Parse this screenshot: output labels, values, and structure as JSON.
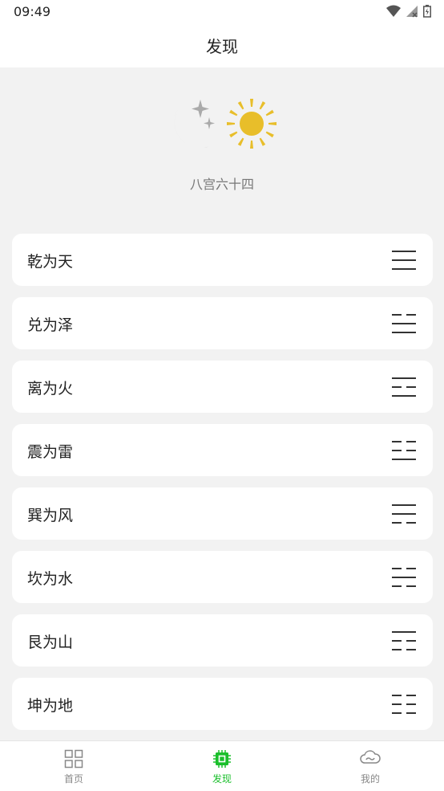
{
  "status_bar": {
    "time": "09:49"
  },
  "header": {
    "title": "发现"
  },
  "hero": {
    "subtitle": "八宫六十四"
  },
  "colors": {
    "accent": "#1bbf2c",
    "sun": "#e8be2a",
    "moon": "#aaaaaa"
  },
  "hexagrams": [
    {
      "label": "乾为天",
      "lines": [
        "yang",
        "yang",
        "yang"
      ]
    },
    {
      "label": "兑为泽",
      "lines": [
        "yin",
        "yang",
        "yang"
      ]
    },
    {
      "label": "离为火",
      "lines": [
        "yang",
        "yin",
        "yang"
      ]
    },
    {
      "label": "震为雷",
      "lines": [
        "yin",
        "yin",
        "yang"
      ]
    },
    {
      "label": "巽为风",
      "lines": [
        "yang",
        "yang",
        "yin"
      ]
    },
    {
      "label": "坎为水",
      "lines": [
        "yin",
        "yang",
        "yin"
      ]
    },
    {
      "label": "艮为山",
      "lines": [
        "yang",
        "yin",
        "yin"
      ]
    },
    {
      "label": "坤为地",
      "lines": [
        "yin",
        "yin",
        "yin"
      ]
    }
  ],
  "tabbar": {
    "tabs": [
      {
        "label": "首页",
        "icon": "grid-icon",
        "active": false
      },
      {
        "label": "发现",
        "icon": "chip-icon",
        "active": true
      },
      {
        "label": "我的",
        "icon": "cloud-icon",
        "active": false
      }
    ]
  }
}
